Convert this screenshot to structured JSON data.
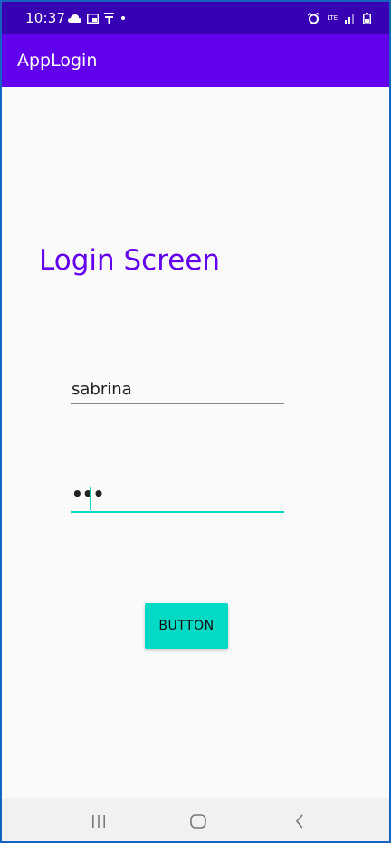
{
  "status_bar": {
    "time": "10:37",
    "lte_label": "LTE",
    "icons": {
      "left": [
        "cloud-icon",
        "cast-icon",
        "usb-icon",
        "notification-dot-icon"
      ],
      "right": [
        "alarm-icon",
        "lte-icon",
        "signal-icon",
        "battery-icon"
      ]
    }
  },
  "app_bar": {
    "title": "AppLogin"
  },
  "screen": {
    "title": "Login Screen",
    "username": {
      "value": "sabrina"
    },
    "password": {
      "value": "•••"
    },
    "button_label": "BUTTON"
  },
  "nav_bar": {
    "icons": [
      "recent-apps-icon",
      "home-icon",
      "back-icon"
    ]
  },
  "colors": {
    "status_bar": "#3700b3",
    "app_bar": "#6200ee",
    "accent": "#03dac5",
    "title_text": "#6200ee",
    "background": "#fafafa",
    "frame_border": "#1565c0"
  }
}
